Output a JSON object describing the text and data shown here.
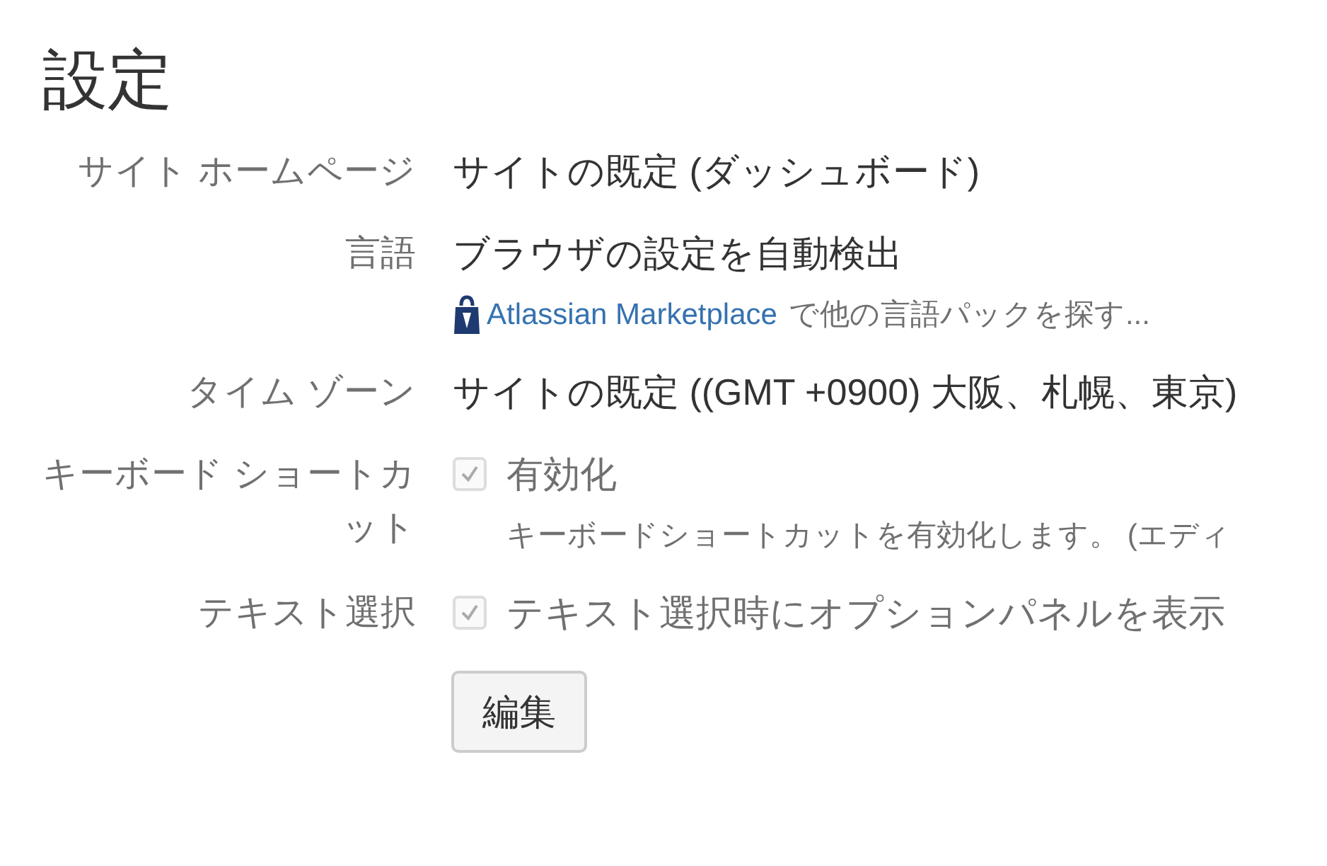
{
  "title": "設定",
  "settings": [
    {
      "label": "サイト ホームページ",
      "kind": "text",
      "value": "サイトの既定 (ダッシュボード)"
    },
    {
      "label": "言語",
      "kind": "text",
      "value": "ブラウザの設定を自動検出",
      "link": "Atlassian Marketplace",
      "link_suffix": "で他の言語パックを探す..."
    },
    {
      "label": "タイム ゾーン",
      "kind": "text",
      "value": "サイトの既定 ((GMT +0900) 大阪、札幌、東京)"
    },
    {
      "label": "キーボード ショートカット",
      "kind": "checkbox",
      "value": "有効化",
      "checked": true,
      "disabled": true,
      "description": "キーボードショートカットを有効化します。 (エディ"
    },
    {
      "label": "テキスト選択",
      "kind": "checkbox",
      "value": "テキスト選択時にオプションパネルを表示",
      "checked": true,
      "disabled": true
    }
  ],
  "edit_button": "編集"
}
